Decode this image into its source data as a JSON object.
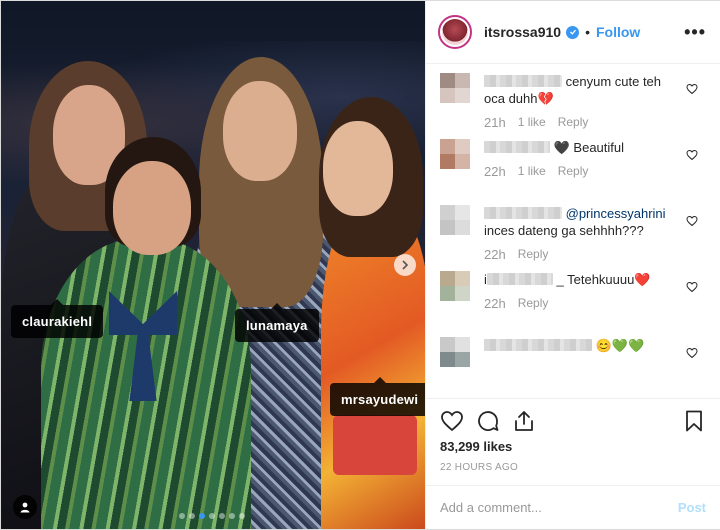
{
  "header": {
    "username": "itsrossa910",
    "separator": "•",
    "follow_label": "Follow",
    "more_label": "•••"
  },
  "photo": {
    "tags": [
      {
        "label": "claurakiehl"
      },
      {
        "label": "lunamaya"
      },
      {
        "label": "mrsayudewi"
      }
    ],
    "carousel": {
      "count": 7,
      "active_index": 2
    }
  },
  "comments": [
    {
      "text": "cenyum cute teh oca duhh💔",
      "time": "21h",
      "likes": "1 like",
      "reply": "Reply"
    },
    {
      "text": "🖤 Beautiful",
      "time": "22h",
      "likes": "1 like",
      "reply": "Reply"
    },
    {
      "mention": "@princessyahrini",
      "text": "inces dateng ga sehhhh???",
      "time": "22h",
      "reply": "Reply"
    },
    {
      "text": "_ Tetehkuuuu❤️",
      "time": "22h",
      "reply": "Reply"
    },
    {
      "text": "😊💚💚"
    }
  ],
  "actions": {
    "like_icon": "heart-icon",
    "comment_icon": "comment-icon",
    "share_icon": "share-icon",
    "save_icon": "bookmark-icon"
  },
  "likes": "83,299 likes",
  "date": "22 HOURS AGO",
  "add_comment": {
    "placeholder": "Add a comment...",
    "post_label": "Post"
  },
  "colors": {
    "accent": "#3897f0",
    "text": "#262626",
    "muted": "#999999",
    "post_disabled": "#b2dffc",
    "ring": "#c13584"
  }
}
